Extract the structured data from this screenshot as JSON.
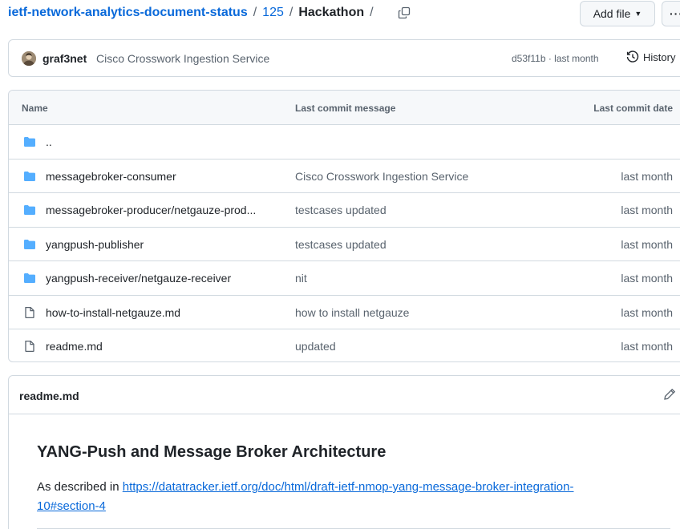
{
  "breadcrumb": {
    "repo": "ietf-network-analytics-document-status",
    "sep1": "/",
    "folder": "125",
    "sep2": "/",
    "current": "Hackathon",
    "sep3": "/"
  },
  "toolbar": {
    "add_file_label": "Add file",
    "more_label": "···"
  },
  "commit": {
    "author": "graf3net",
    "message": "Cisco Crosswork Ingestion Service",
    "meta": "d53f11b · last month",
    "history_label": "History"
  },
  "table": {
    "headers": {
      "name": "Name",
      "message": "Last commit message",
      "date": "Last commit date"
    },
    "parent": "..",
    "rows": [
      {
        "type": "folder",
        "name": "messagebroker-consumer",
        "message": "Cisco Crosswork Ingestion Service",
        "date": "last month"
      },
      {
        "type": "folder",
        "name": "messagebroker-producer/netgauze-prod...",
        "message": "testcases updated",
        "date": "last month"
      },
      {
        "type": "folder",
        "name": "yangpush-publisher",
        "message": "testcases updated",
        "date": "last month"
      },
      {
        "type": "folder",
        "name": "yangpush-receiver/netgauze-receiver",
        "message": "nit",
        "date": "last month"
      },
      {
        "type": "file",
        "name": "how-to-install-netgauze.md",
        "message": "how to install netgauze",
        "date": "last month"
      },
      {
        "type": "file",
        "name": "readme.md",
        "message": "updated",
        "date": "last month"
      }
    ]
  },
  "readme": {
    "title": "readme.md",
    "heading": "YANG-Push and Message Broker Architecture",
    "intro": "As described in ",
    "link": "https://datatracker.ietf.org/doc/html/draft-ietf-nmop-yang-message-broker-integration-10#section-4"
  },
  "colors": {
    "link": "#0969da",
    "folder_icon": "#54aeff",
    "border": "#d1d9e0",
    "muted_text": "#59636e"
  }
}
